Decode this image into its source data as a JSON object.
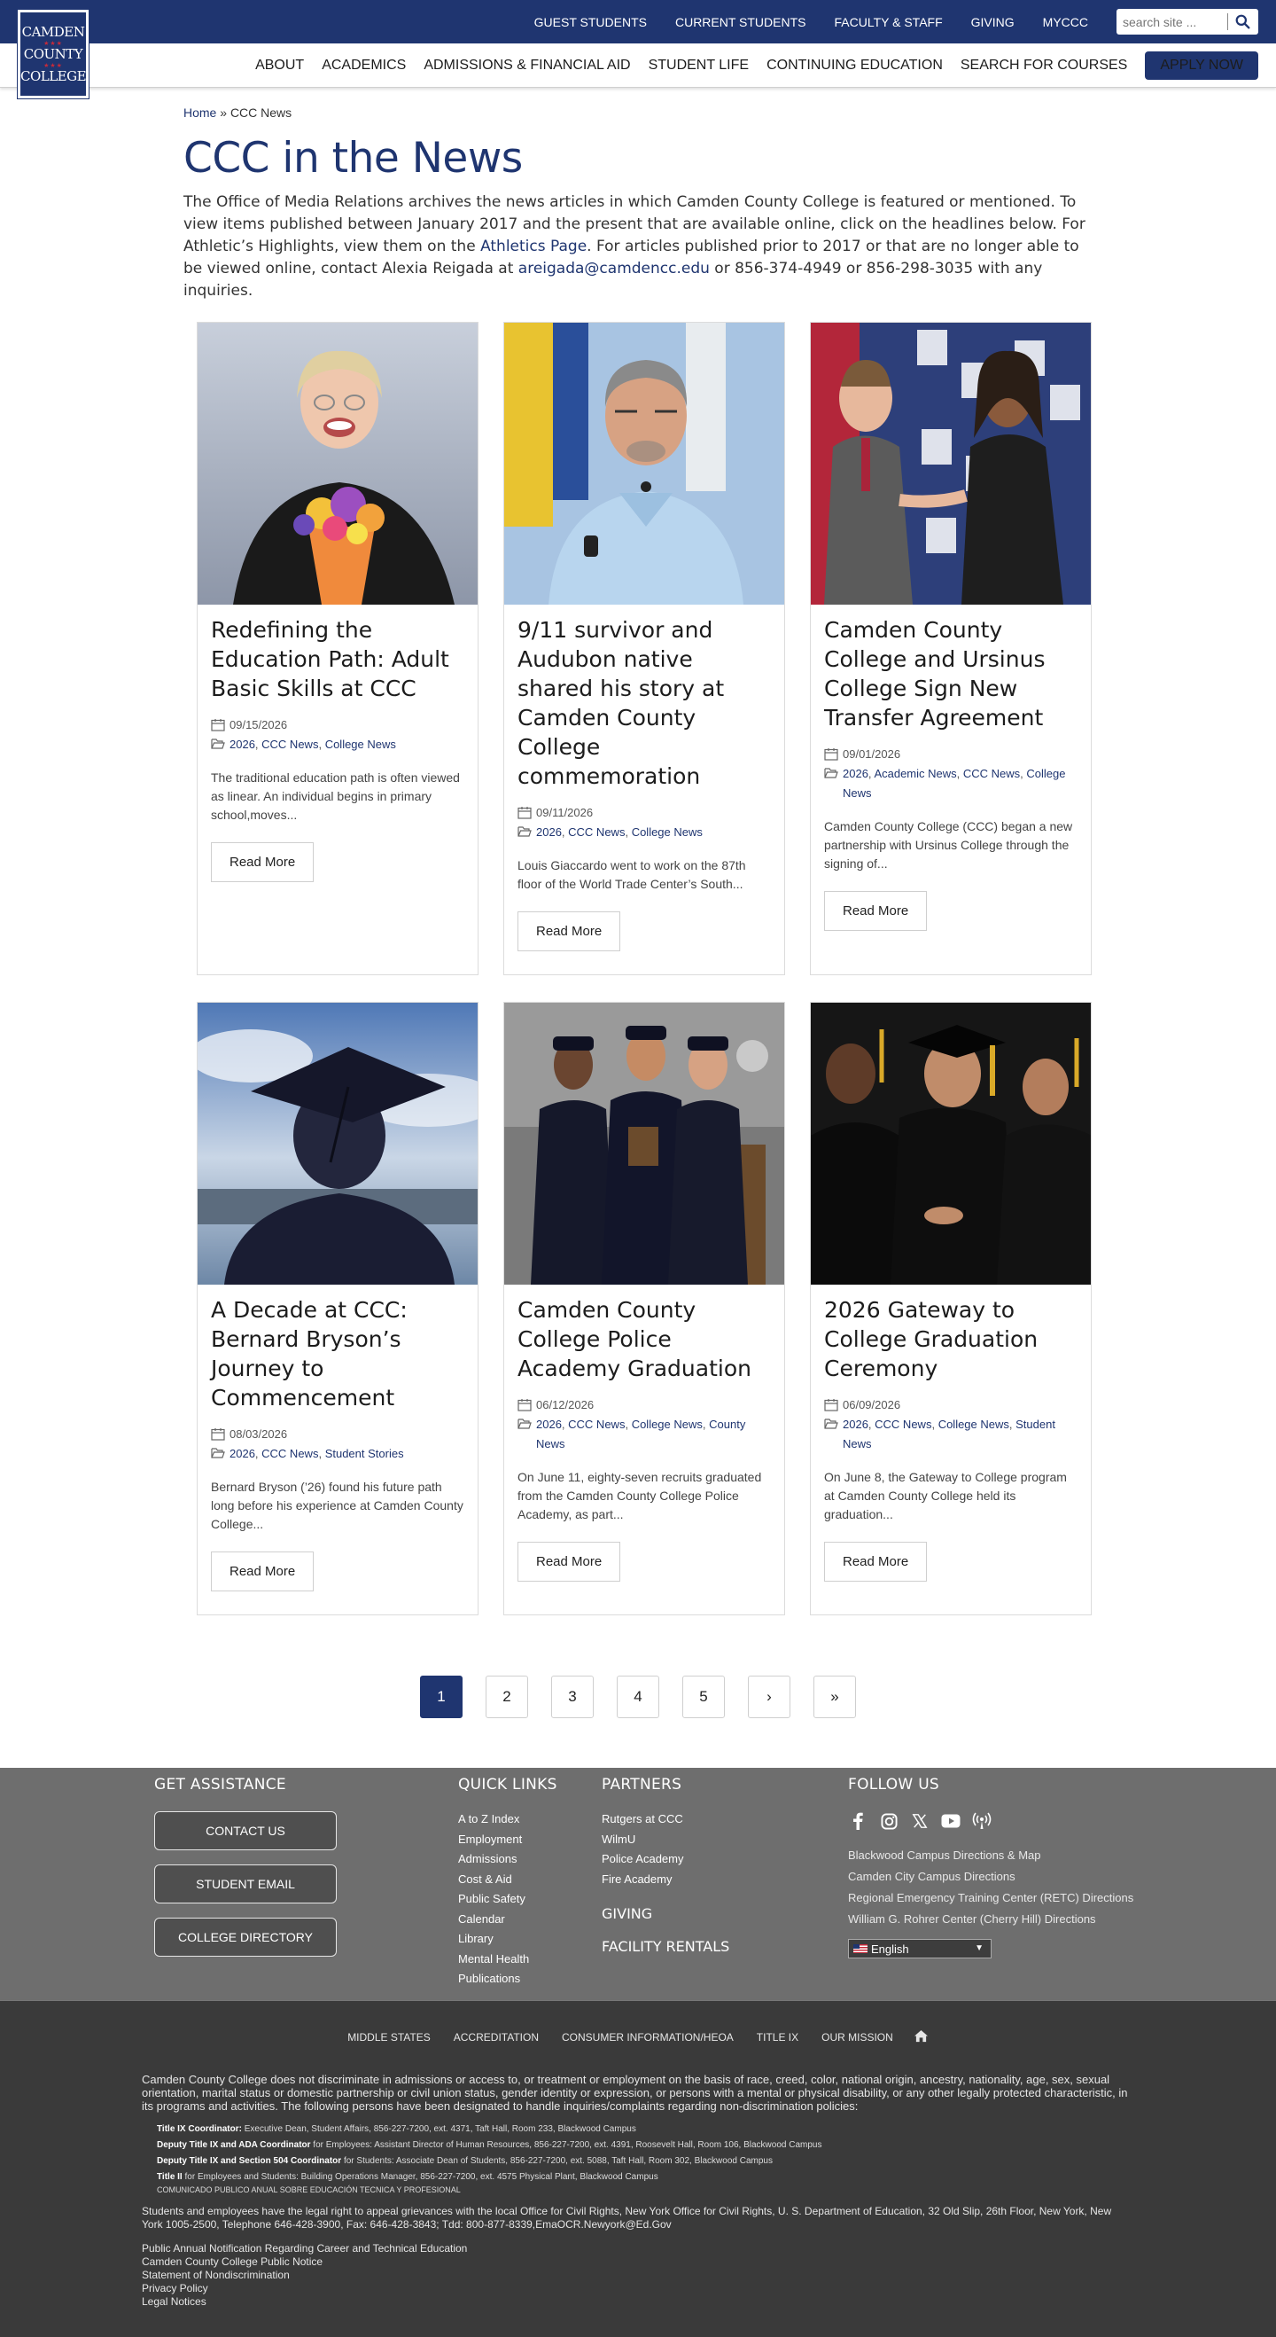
{
  "header": {
    "logo": {
      "line1": "CAMDEN",
      "line2": "COUNTY",
      "line3": "COLLEGE",
      "stars": "★★★"
    },
    "utility_links": [
      "GUEST STUDENTS",
      "CURRENT STUDENTS",
      "FACULTY & STAFF",
      "GIVING",
      "MYCCC"
    ],
    "search": {
      "placeholder": "search site ..."
    },
    "main_nav": [
      "ABOUT",
      "ACADEMICS",
      "ADMISSIONS & FINANCIAL AID",
      "STUDENT LIFE",
      "CONTINUING EDUCATION",
      "SEARCH FOR COURSES"
    ],
    "apply_label": "APPLY NOW"
  },
  "breadcrumb": {
    "home": "Home",
    "separator": " » ",
    "current": "CCC News"
  },
  "page": {
    "title": "CCC in the News",
    "intro": {
      "part1": "The Office of Media Relations archives the news articles in which Camden County College is featured or mentioned. To view items published between January 2017 and the present that are available online, click on the headlines below. For Athletic’s Highlights, view them on the ",
      "athletics_link": "Athletics Page",
      "part2": ". For articles published prior to 2017 or that are no longer able to be viewed online, contact Alexia Reigada at ",
      "email": "areigada@camdencc.edu",
      "part3": " or 856-374-4949 or 856-298-3035 with any inquiries."
    }
  },
  "articles": [
    {
      "title": "Redefining the Education Path: Adult Basic Skills at CCC",
      "date": "09/15/2026",
      "categories": [
        "2026",
        "CCC News",
        "College News"
      ],
      "excerpt": "The traditional education path is often viewed as linear. An individual begins in primary school,moves...",
      "read_more": "Read More"
    },
    {
      "title": "9/11 survivor and Audubon native shared his story at Camden County College commemoration",
      "date": "09/11/2026",
      "categories": [
        "2026",
        "CCC News",
        "College News"
      ],
      "excerpt": "Louis Giaccardo went to work on the 87th floor of the World Trade Center’s South...",
      "read_more": "Read More"
    },
    {
      "title": "Camden County College and Ursinus College Sign New Transfer Agreement",
      "date": "09/01/2026",
      "categories": [
        "2026",
        "Academic News",
        "CCC News",
        "College News"
      ],
      "excerpt": "Camden County College (CCC) began a new partnership with Ursinus College through the signing of...",
      "read_more": "Read More"
    },
    {
      "title": "A Decade at CCC: Bernard Bryson’s Journey to Commencement",
      "date": "08/03/2026",
      "categories": [
        "2026",
        "CCC News",
        "Student Stories"
      ],
      "excerpt": "Bernard Bryson (’26) found his future path long before his experience at Camden County College...",
      "read_more": "Read More"
    },
    {
      "title": "Camden County College Police Academy Graduation",
      "date": "06/12/2026",
      "categories": [
        "2026",
        "CCC News",
        "College News",
        "County News"
      ],
      "excerpt": "On June 11, eighty-seven recruits graduated from the Camden County College Police Academy, as part...",
      "read_more": "Read More"
    },
    {
      "title": "2026 Gateway to College Graduation Ceremony",
      "date": "06/09/2026",
      "categories": [
        "2026",
        "CCC News",
        "College News",
        "Student News"
      ],
      "excerpt": "On June 8, the Gateway to College program at Camden County College held its graduation...",
      "read_more": "Read More"
    }
  ],
  "pagination": {
    "pages": [
      "1",
      "2",
      "3",
      "4",
      "5"
    ],
    "current": "1",
    "next": "›",
    "last": "»"
  },
  "footer": {
    "assistance": {
      "heading": "GET ASSISTANCE",
      "buttons": [
        "CONTACT US",
        "STUDENT EMAIL",
        "COLLEGE DIRECTORY"
      ]
    },
    "quick_links": {
      "heading": "QUICK LINKS",
      "items": [
        "A to Z Index",
        "Employment",
        "Admissions",
        "Cost & Aid",
        "Public Safety",
        "Calendar",
        "Library",
        "Mental Health",
        "Publications"
      ]
    },
    "partners": {
      "heading": "PARTNERS",
      "items": [
        "Rutgers at CCC",
        "WilmU",
        "Police Academy",
        "Fire Academy"
      ],
      "giving": "GIVING",
      "facility_rentals": "FACILITY RENTALS"
    },
    "follow": {
      "heading": "FOLLOW US",
      "social_icons": [
        "facebook-icon",
        "instagram-icon",
        "x-icon",
        "youtube-icon",
        "podcast-icon"
      ],
      "directions": [
        "Blackwood Campus Directions & Map",
        "Camden City Campus Directions",
        "Regional Emergency Training Center (RETC) Directions",
        "William G. Rohrer Center (Cherry Hill) Directions"
      ],
      "language": "English"
    },
    "bottom_links": [
      "MIDDLE STATES",
      "ACCREDITATION",
      "CONSUMER INFORMATION/HEOA",
      "TITLE IX",
      "OUR MISSION"
    ],
    "nondiscrimination": "Camden County College does not discriminate in admissions or access to, or treatment or employment on the basis of race, creed, color, national origin, ancestry, nationality, age, sex, sexual orientation, marital status or domestic partnership or civil union status, gender identity or expression, or persons with a mental or physical disability, or any other legally protected characteristic, in its programs and activities. The following persons have been designated to handle inquiries/complaints regarding non-discrimination policies:",
    "coordinators": [
      {
        "role": "Title IX Coordinator:",
        "text": " Executive Dean, Student Affairs, 856-227-7200, ext. 4371, Taft Hall, Room 233, Blackwood Campus"
      },
      {
        "role": "Deputy Title IX and ADA Coordinator",
        "text": " for Employees: Assistant Director of Human Resources, 856-227-7200, ext. 4391, Roosevelt Hall, Room 106, Blackwood Campus"
      },
      {
        "role": "Deputy Title IX and Section 504 Coordinator",
        "text": " for Students: Associate Dean of Students, 856-227-7200, ext. 5088, Taft Hall, Room 302, Blackwood Campus"
      },
      {
        "role": "Title II",
        "text": " for Employees and Students: Building Operations Manager, 856-227-7200, ext. 4575 Physical Plant, Blackwood Campus"
      }
    ],
    "spanish_notice": "COMUNICADO PUBLICO ANUAL SOBRE EDUCACIÓN TECNICA Y PROFESIONAL",
    "rights": "Students and employees have the legal right to appeal grievances with the local Office for Civil Rights, New York Office for Civil Rights, U. S. Department of Education, 32 Old Slip, 26th Floor, New York, New York 1005-2500, Telephone 646-428-3900, Fax: 646-428-3843; Tdd: 800-877-8339,EmaOCR.Newyork@Ed.Gov",
    "legal_links": [
      "Public Annual Notification Regarding Career and Technical Education",
      "Camden County College Public Notice",
      "Statement of Nondiscrimination",
      "Privacy Policy",
      "Legal Notices"
    ]
  },
  "colors": {
    "brand_navy": "#1f3570",
    "accent_red": "#c62a3a",
    "footer_gray": "#6e6e6e",
    "footer_dark": "#3a3a3a"
  }
}
